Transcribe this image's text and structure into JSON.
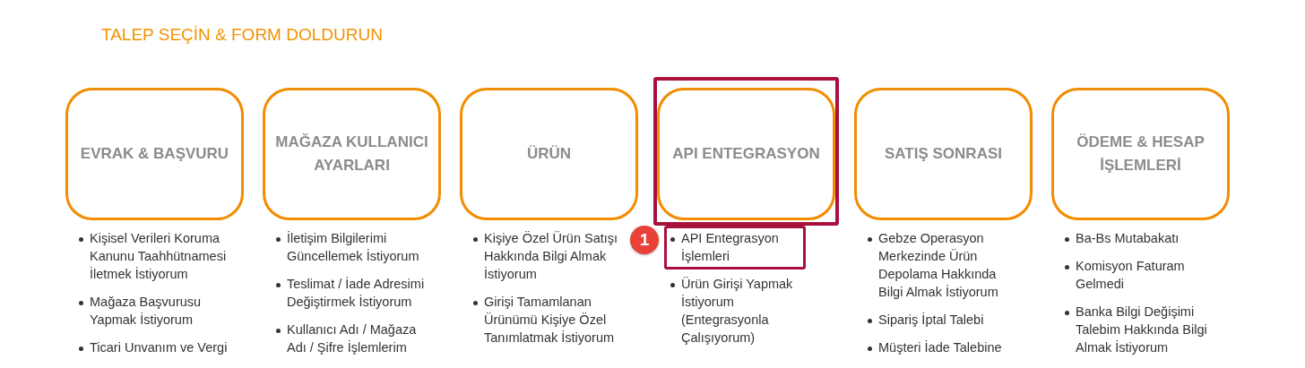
{
  "heading": "TALEP SEÇİN & FORM DOLDURUN",
  "categories": [
    {
      "title": "EVRAK & BAŞVURU",
      "selected": false,
      "items": [
        {
          "text": "Kişisel Verileri Koruma Kanunu Taahhütnamesi İletmek İstiyorum",
          "selected": false
        },
        {
          "text": "Mağaza Başvurusu Yapmak İstiyorum",
          "selected": false
        },
        {
          "text": "Ticari Unvanım ve Vergi",
          "selected": false
        }
      ]
    },
    {
      "title": "MAĞAZA KULLANICI AYARLARI",
      "selected": false,
      "items": [
        {
          "text": "İletişim Bilgilerimi Güncellemek İstiyorum",
          "selected": false
        },
        {
          "text": "Teslimat / İade Adresimi Değiştirmek İstiyorum",
          "selected": false
        },
        {
          "text": "Kullanıcı Adı / Mağaza Adı / Şifre İşlemlerim",
          "selected": false
        }
      ]
    },
    {
      "title": "ÜRÜN",
      "selected": false,
      "items": [
        {
          "text": "Kişiye Özel Ürün Satışı Hakkında Bilgi Almak İstiyorum",
          "selected": false
        },
        {
          "text": "Girişi Tamamlanan Ürünümü Kişiye Özel Tanımlatmak İstiyorum",
          "selected": false
        }
      ]
    },
    {
      "title": "API ENTEGRASYON",
      "selected": true,
      "items": [
        {
          "text": "API Entegrasyon İşlemleri",
          "selected": true,
          "badge": "1"
        },
        {
          "text": "Ürün Girişi Yapmak İstiyorum (Entegrasyonla Çalışıyorum)",
          "selected": false
        }
      ]
    },
    {
      "title": "SATIŞ SONRASI",
      "selected": false,
      "items": [
        {
          "text": "Gebze Operasyon Merkezinde Ürün Depolama Hakkında Bilgi Almak İstiyorum",
          "selected": false
        },
        {
          "text": "Sipariş İptal Talebi",
          "selected": false
        },
        {
          "text": "Müşteri İade Talebine",
          "selected": false
        }
      ]
    },
    {
      "title": "ÖDEME & HESAP İŞLEMLERİ",
      "selected": false,
      "items": [
        {
          "text": "Ba-Bs Mutabakatı",
          "selected": false
        },
        {
          "text": "Komisyon Faturam Gelmedi",
          "selected": false
        },
        {
          "text": "Banka Bilgi Değişimi Talebim Hakkında Bilgi Almak İstiyorum",
          "selected": false
        }
      ]
    }
  ]
}
